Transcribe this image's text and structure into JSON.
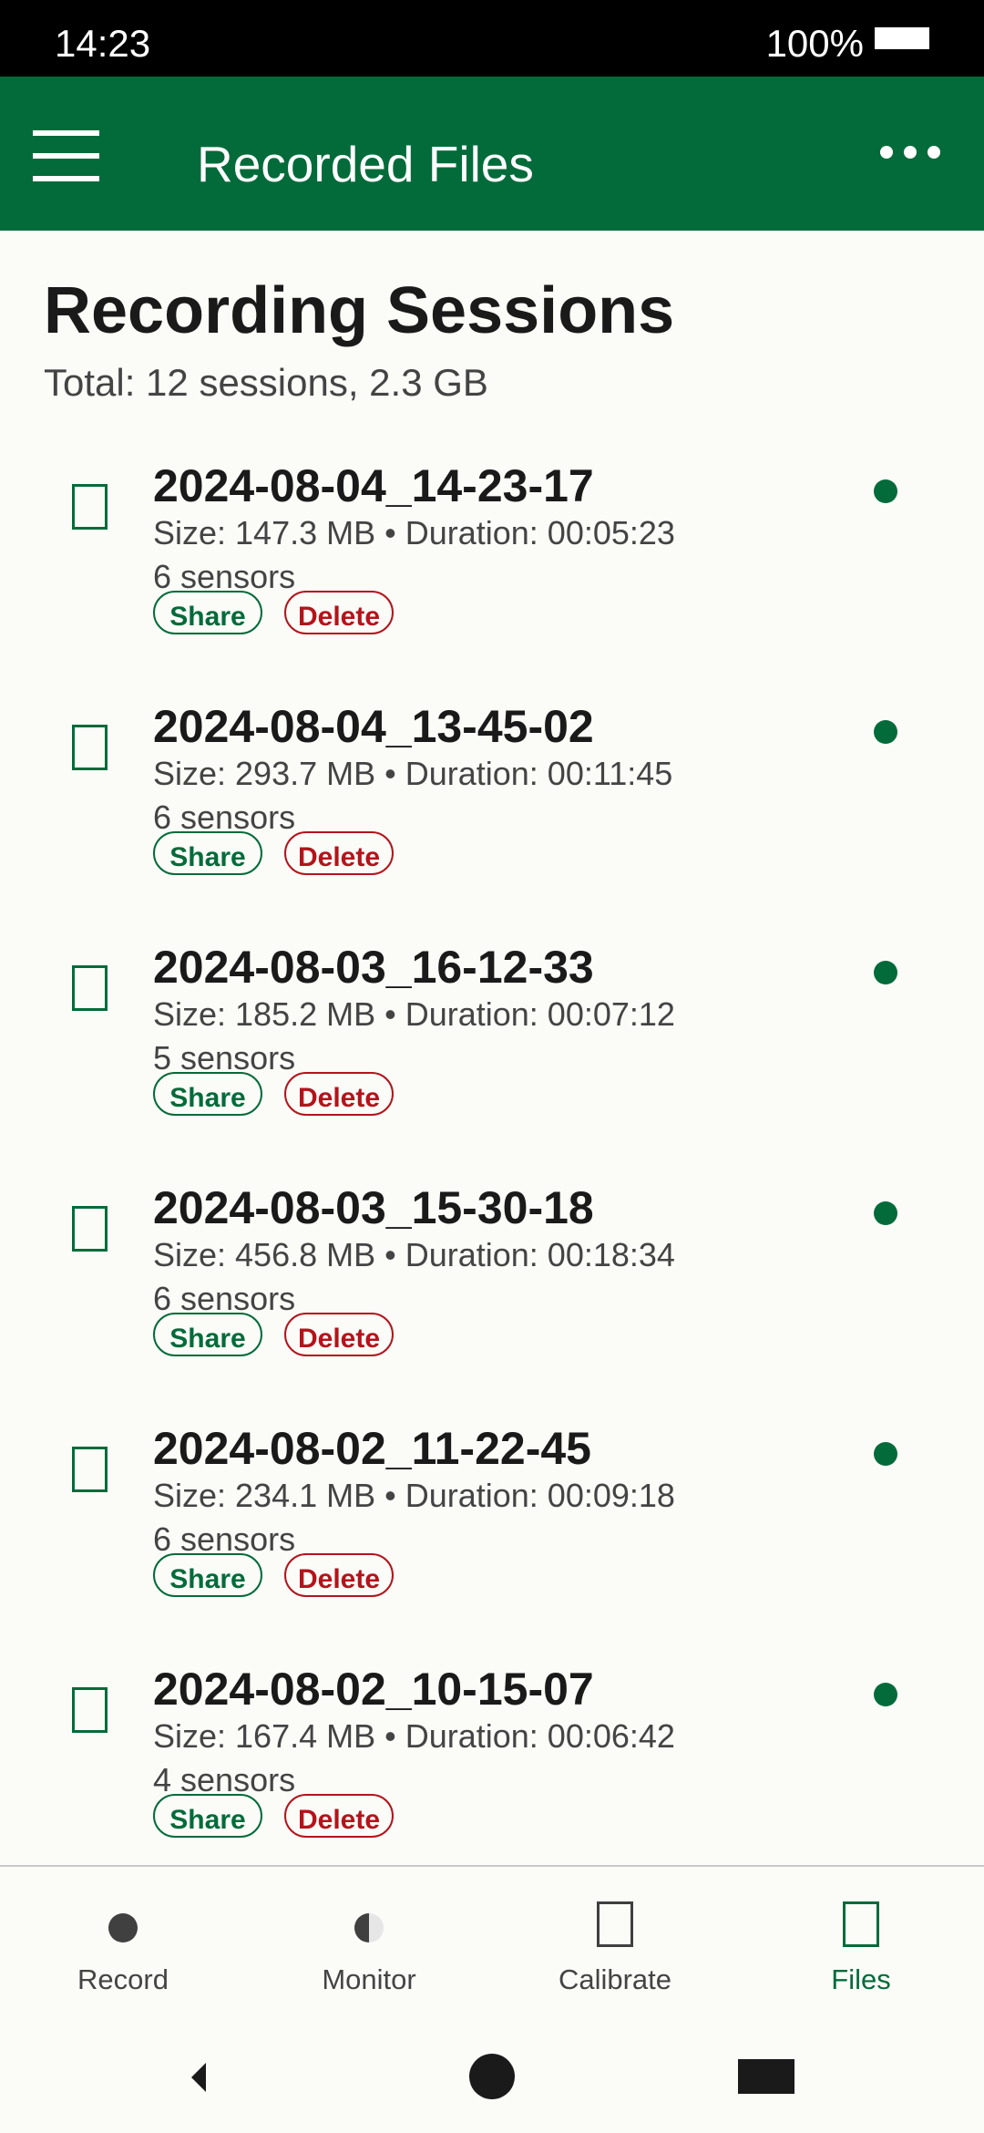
{
  "status_bar": {
    "time": "14:23",
    "battery": "100%"
  },
  "app_bar": {
    "title": "Recorded Files"
  },
  "header": {
    "title": "Recording Sessions",
    "summary": "Total: 12 sessions, 2.3 GB"
  },
  "sessions": [
    {
      "name": "2024-08-04_14-23-17",
      "meta": "Size: 147.3 MB • Duration: 00:05:23",
      "sensors": "6 sensors",
      "share": "Share",
      "delete": "Delete"
    },
    {
      "name": "2024-08-04_13-45-02",
      "meta": "Size: 293.7 MB • Duration: 00:11:45",
      "sensors": "6 sensors",
      "share": "Share",
      "delete": "Delete"
    },
    {
      "name": "2024-08-03_16-12-33",
      "meta": "Size: 185.2 MB • Duration: 00:07:12",
      "sensors": "5 sensors",
      "share": "Share",
      "delete": "Delete"
    },
    {
      "name": "2024-08-03_15-30-18",
      "meta": "Size: 456.8 MB • Duration: 00:18:34",
      "sensors": "6 sensors",
      "share": "Share",
      "delete": "Delete"
    },
    {
      "name": "2024-08-02_11-22-45",
      "meta": "Size: 234.1 MB • Duration: 00:09:18",
      "sensors": "6 sensors",
      "share": "Share",
      "delete": "Delete"
    },
    {
      "name": "2024-08-02_10-15-07",
      "meta": "Size: 167.4 MB • Duration: 00:06:42",
      "sensors": "4 sensors",
      "share": "Share",
      "delete": "Delete"
    }
  ],
  "bottom_nav": [
    {
      "label": "Record",
      "icon": "record-dot-icon"
    },
    {
      "label": "Monitor",
      "icon": "half-circle-icon"
    },
    {
      "label": "Calibrate",
      "icon": "rectangle-icon"
    },
    {
      "label": "Files",
      "icon": "rectangle-icon",
      "active": true
    }
  ],
  "colors": {
    "primary": "#036b3a",
    "danger": "#b3141c",
    "background": "#fbfcf8"
  }
}
